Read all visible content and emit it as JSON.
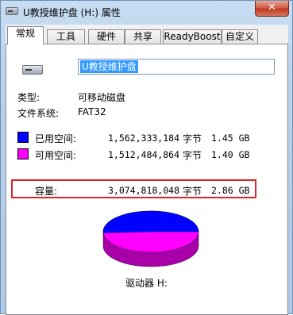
{
  "window": {
    "title": "U教授维护盘 (H:) 属性",
    "close_label": "✕"
  },
  "tabs": [
    {
      "label": "常规"
    },
    {
      "label": "工具"
    },
    {
      "label": "硬件"
    },
    {
      "label": "共享"
    },
    {
      "label": "ReadyBoost"
    },
    {
      "label": "自定义"
    }
  ],
  "general": {
    "drive_icon": "removable-drive-icon",
    "volume_name": "U教授维护盘",
    "type_label": "类型:",
    "type_value": "可移动磁盘",
    "fs_label": "文件系统:",
    "fs_value": "FAT32",
    "used": {
      "label": "已用空间:",
      "bytes": "1,562,333,184",
      "unit": "字节",
      "size": "1.45 GB",
      "color": "#0000ff"
    },
    "free": {
      "label": "可用空间:",
      "bytes": "1,512,484,864",
      "unit": "字节",
      "size": "1.40 GB",
      "color": "#ff00ff"
    },
    "capacity": {
      "label": "容量:",
      "bytes": "3,074,818,048",
      "unit": "字节",
      "size": "2.86 GB"
    },
    "drive_label": "驱动器 H:",
    "used_fraction": 0.508
  },
  "colors": {
    "highlight_border": "#d8262b"
  }
}
